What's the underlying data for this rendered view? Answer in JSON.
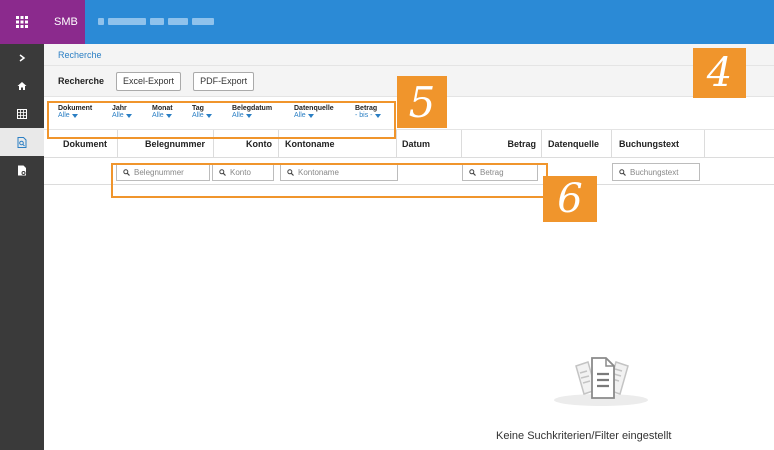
{
  "topbar": {
    "brand": "SMB",
    "grid_icon": "apps-grid-icon",
    "accent": "#2b8ad6",
    "brand_color": "#8b2a8d"
  },
  "sidebar": {
    "items": [
      {
        "icon": "chevron-right-icon"
      },
      {
        "icon": "home-icon"
      },
      {
        "icon": "table-icon"
      },
      {
        "icon": "search-document-icon",
        "active": true
      },
      {
        "icon": "document-settings-icon"
      }
    ]
  },
  "breadcrumb": {
    "item": "Recherche"
  },
  "toolbar": {
    "title": "Recherche",
    "excel_label": "Excel-Export",
    "pdf_label": "PDF-Export"
  },
  "filters": [
    {
      "label": "Dokument",
      "value": "Alle"
    },
    {
      "label": "Jahr",
      "value": "Alle"
    },
    {
      "label": "Monat",
      "value": "Alle"
    },
    {
      "label": "Tag",
      "value": "Alle"
    },
    {
      "label": "Belegdatum",
      "value": "Alle"
    },
    {
      "label": "Datenquelle",
      "value": "Alle"
    },
    {
      "label": "Betrag",
      "value": "- bis -"
    }
  ],
  "table": {
    "columns": [
      "Dokument",
      "Belegnummer",
      "Konto",
      "Kontoname",
      "Datum",
      "Betrag",
      "Datenquelle",
      "Buchungstext"
    ],
    "search": {
      "belegnummer": "Belegnummer",
      "konto": "Konto",
      "kontoname": "Kontoname",
      "betrag": "Betrag",
      "buchungstext": "Buchungstext"
    }
  },
  "empty_state": {
    "message": "Keine Suchkriterien/Filter eingestellt",
    "icon": "documents-icon"
  },
  "callouts": {
    "four": "4",
    "five": "5",
    "six": "6",
    "color": "#f0952c"
  }
}
